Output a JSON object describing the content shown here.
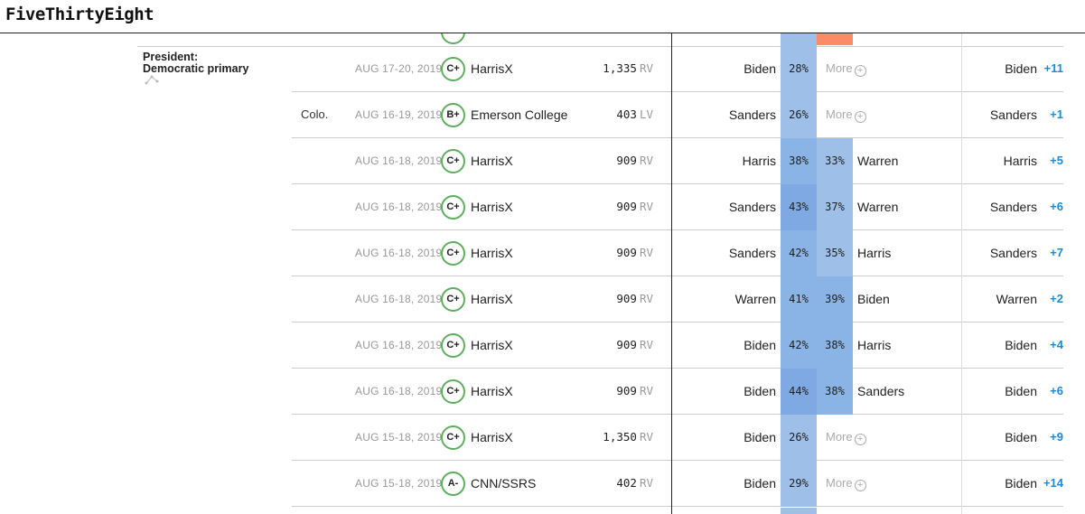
{
  "brand": {
    "logo": "FiveThirtyEight"
  },
  "section": {
    "line1": "President:",
    "line2": "Democratic primary"
  },
  "colors": {
    "accent_blue": "#1a8bd6",
    "light_blue": "#9dbfe8",
    "mid_blue": "#8ab4e6",
    "dark_blue": "#7ea9e2",
    "orange": "#fa8b67",
    "grade_green": "#5fae5f"
  },
  "more_label": "More",
  "rows": [
    {
      "state": "",
      "date": "AUG 17-20, 2019",
      "grade": "C+",
      "pollster": "HarrisX",
      "sample": "1,335",
      "sample_type": "RV",
      "cand1": "Biden",
      "pct1": "28%",
      "cand2": "",
      "pct2": "",
      "leader": "Biden",
      "margin": "+11",
      "has_more": true
    },
    {
      "state": "Colo.",
      "date": "AUG 16-19, 2019",
      "grade": "B+",
      "pollster": "Emerson College",
      "sample": "403",
      "sample_type": "LV",
      "cand1": "Sanders",
      "pct1": "26%",
      "cand2": "",
      "pct2": "",
      "leader": "Sanders",
      "margin": "+1",
      "has_more": true
    },
    {
      "state": "",
      "date": "AUG 16-18, 2019",
      "grade": "C+",
      "pollster": "HarrisX",
      "sample": "909",
      "sample_type": "RV",
      "cand1": "Harris",
      "pct1": "38%",
      "cand2": "Warren",
      "pct2": "33%",
      "leader": "Harris",
      "margin": "+5",
      "has_more": false
    },
    {
      "state": "",
      "date": "AUG 16-18, 2019",
      "grade": "C+",
      "pollster": "HarrisX",
      "sample": "909",
      "sample_type": "RV",
      "cand1": "Sanders",
      "pct1": "43%",
      "cand2": "Warren",
      "pct2": "37%",
      "leader": "Sanders",
      "margin": "+6",
      "has_more": false
    },
    {
      "state": "",
      "date": "AUG 16-18, 2019",
      "grade": "C+",
      "pollster": "HarrisX",
      "sample": "909",
      "sample_type": "RV",
      "cand1": "Sanders",
      "pct1": "42%",
      "cand2": "Harris",
      "pct2": "35%",
      "leader": "Sanders",
      "margin": "+7",
      "has_more": false
    },
    {
      "state": "",
      "date": "AUG 16-18, 2019",
      "grade": "C+",
      "pollster": "HarrisX",
      "sample": "909",
      "sample_type": "RV",
      "cand1": "Warren",
      "pct1": "41%",
      "cand2": "Biden",
      "pct2": "39%",
      "leader": "Warren",
      "margin": "+2",
      "has_more": false
    },
    {
      "state": "",
      "date": "AUG 16-18, 2019",
      "grade": "C+",
      "pollster": "HarrisX",
      "sample": "909",
      "sample_type": "RV",
      "cand1": "Biden",
      "pct1": "42%",
      "cand2": "Harris",
      "pct2": "38%",
      "leader": "Biden",
      "margin": "+4",
      "has_more": false
    },
    {
      "state": "",
      "date": "AUG 16-18, 2019",
      "grade": "C+",
      "pollster": "HarrisX",
      "sample": "909",
      "sample_type": "RV",
      "cand1": "Biden",
      "pct1": "44%",
      "cand2": "Sanders",
      "pct2": "38%",
      "leader": "Biden",
      "margin": "+6",
      "has_more": false
    },
    {
      "state": "",
      "date": "AUG 15-18, 2019",
      "grade": "C+",
      "pollster": "HarrisX",
      "sample": "1,350",
      "sample_type": "RV",
      "cand1": "Biden",
      "pct1": "26%",
      "cand2": "",
      "pct2": "",
      "leader": "Biden",
      "margin": "+9",
      "has_more": true
    },
    {
      "state": "",
      "date": "AUG 15-18, 2019",
      "grade": "A-",
      "pollster": "CNN/SSRS",
      "sample": "402",
      "sample_type": "RV",
      "cand1": "Biden",
      "pct1": "29%",
      "cand2": "",
      "pct2": "",
      "leader": "Biden",
      "margin": "+14",
      "has_more": true
    }
  ]
}
